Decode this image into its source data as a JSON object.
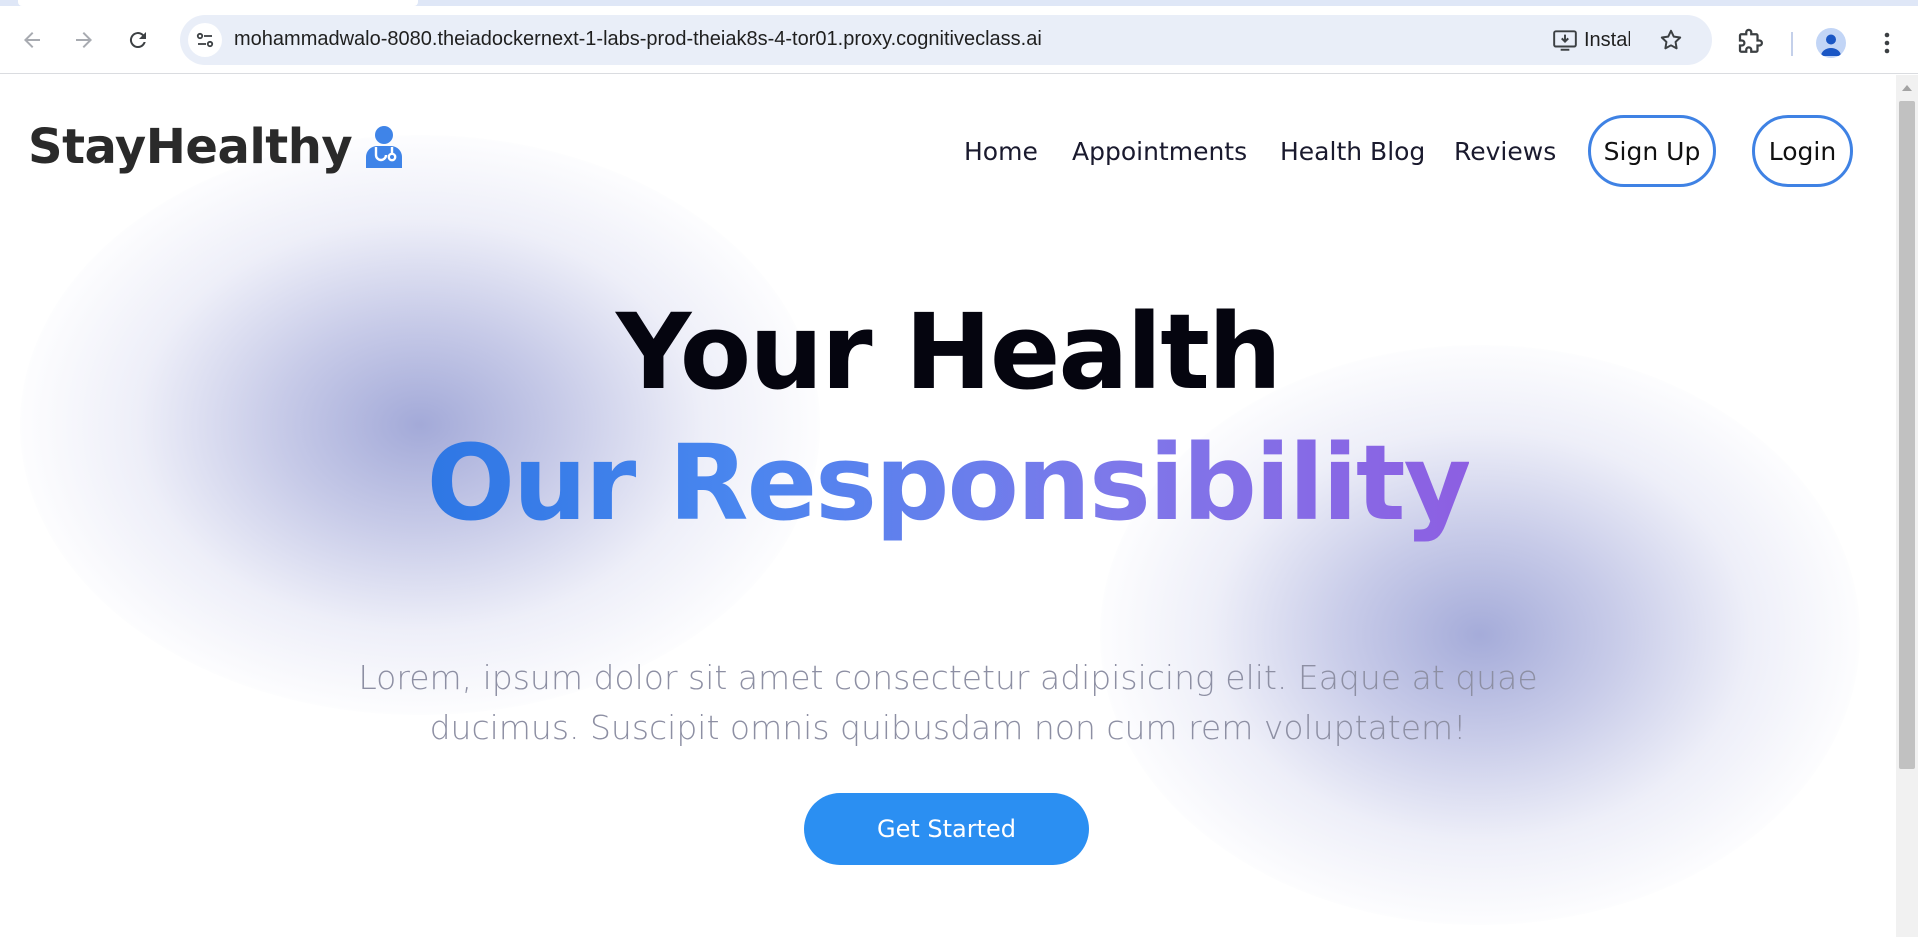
{
  "browser": {
    "url": "mohammadwalo-8080.theiadockernext-1-labs-prod-theiak8s-4-tor01.proxy.cognitiveclass.ai",
    "install_label": "Install",
    "icons": {
      "back": "back-arrow-icon",
      "forward": "forward-arrow-icon",
      "reload": "reload-icon",
      "site_info": "tune-icon",
      "install": "install-app-icon",
      "bookmark": "star-icon",
      "extensions": "puzzle-icon",
      "profile": "profile-icon",
      "menu": "kebab-menu-icon"
    }
  },
  "header": {
    "logo_text": "StayHealthy",
    "logo_icon": "doctor-stethoscope-icon",
    "nav": {
      "home": "Home",
      "appointments": "Appointments",
      "health_blog": "Health Blog",
      "reviews": "Reviews",
      "sign_up": "Sign Up",
      "login": "Login"
    }
  },
  "hero": {
    "title_line1": "Your Health",
    "title_line2": "Our Responsibility",
    "description": "Lorem, ipsum dolor sit amet consectetur adipisicing elit. Eaque at quae ducimus. Suscipit omnis quibusdam non cum rem voluptatem!",
    "cta_label": "Get Started"
  },
  "colors": {
    "accent": "#2b8ff2",
    "pill_border": "#3f82e4",
    "gradient_start": "#2e77e4",
    "gradient_end": "#8d5fe2",
    "text_dark": "#05050f",
    "text_muted": "#8d8fa3"
  }
}
